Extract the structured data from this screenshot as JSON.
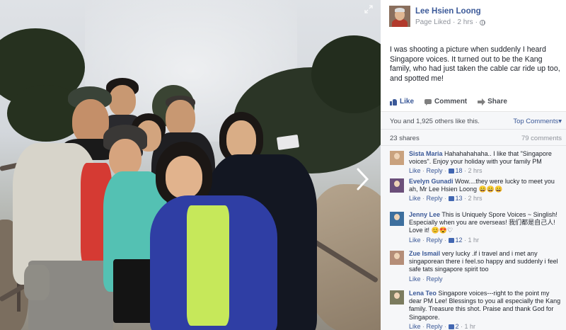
{
  "post": {
    "page_name": "Lee Hsien Loong",
    "meta_status": "Page Liked",
    "meta_separator": "·",
    "time": "2 hrs",
    "audience_icon": "globe-icon",
    "text": "I was shooting a picture when suddenly I heard Singapore voices. It turned out to be the Kang family, who had just taken the cable car ride up too, and spotted me!"
  },
  "actions": {
    "like": "Like",
    "comment": "Comment",
    "share": "Share"
  },
  "stats": {
    "likes_summary": "You and 1,925 others like this.",
    "top_comments": "Top Comments",
    "top_comments_arrow": "▾",
    "shares": "23 shares",
    "comments": "79 comments"
  },
  "comment_ui": {
    "like": "Like",
    "reply": "Reply",
    "separator": "·"
  },
  "comments": [
    {
      "author": "Sista Maria",
      "text": "Hahahahahaha.. I like that \"Singapore voices\". Enjoy your holiday with your family PM",
      "emoji": "",
      "likes": "18",
      "time": "2 hrs",
      "avatar_color": "#c9a27e"
    },
    {
      "author": "Evelyn Gunadi",
      "text": "Wow....they were lucky to meet you ah, Mr Lee Hsien Loong",
      "emoji": "😄😄😄",
      "likes": "13",
      "time": "2 hrs",
      "avatar_color": "#6b4f7a"
    },
    {
      "author": "Jenny Lee",
      "text": "This is Uniquely Spore Voices ~ Singlish! Especially when you are overseas! 我们都是自己人! Love it!",
      "emoji": "😊😍♡",
      "likes": "12",
      "time": "1 hr",
      "avatar_color": "#3d6f9e"
    },
    {
      "author": "Zue Ismail",
      "text": "very lucky .if i travel and i met any singaporean there i feel.so happy and suddenly i feel safe tats singapore spirit too",
      "emoji": "",
      "likes": "",
      "time": "",
      "avatar_color": "#b58e78"
    },
    {
      "author": "Lena Teo",
      "text": "Singapore voices---right to the point my dear PM Lee! Blessings to you all especially the Kang family. Treasure this shot. Praise and thank God for Singapore.",
      "emoji": "",
      "likes": "2",
      "time": "1 hr",
      "avatar_color": "#7b7b5e"
    }
  ],
  "photo": {
    "expand_icon": "expand-icon",
    "next_icon": "chevron-right-icon"
  }
}
